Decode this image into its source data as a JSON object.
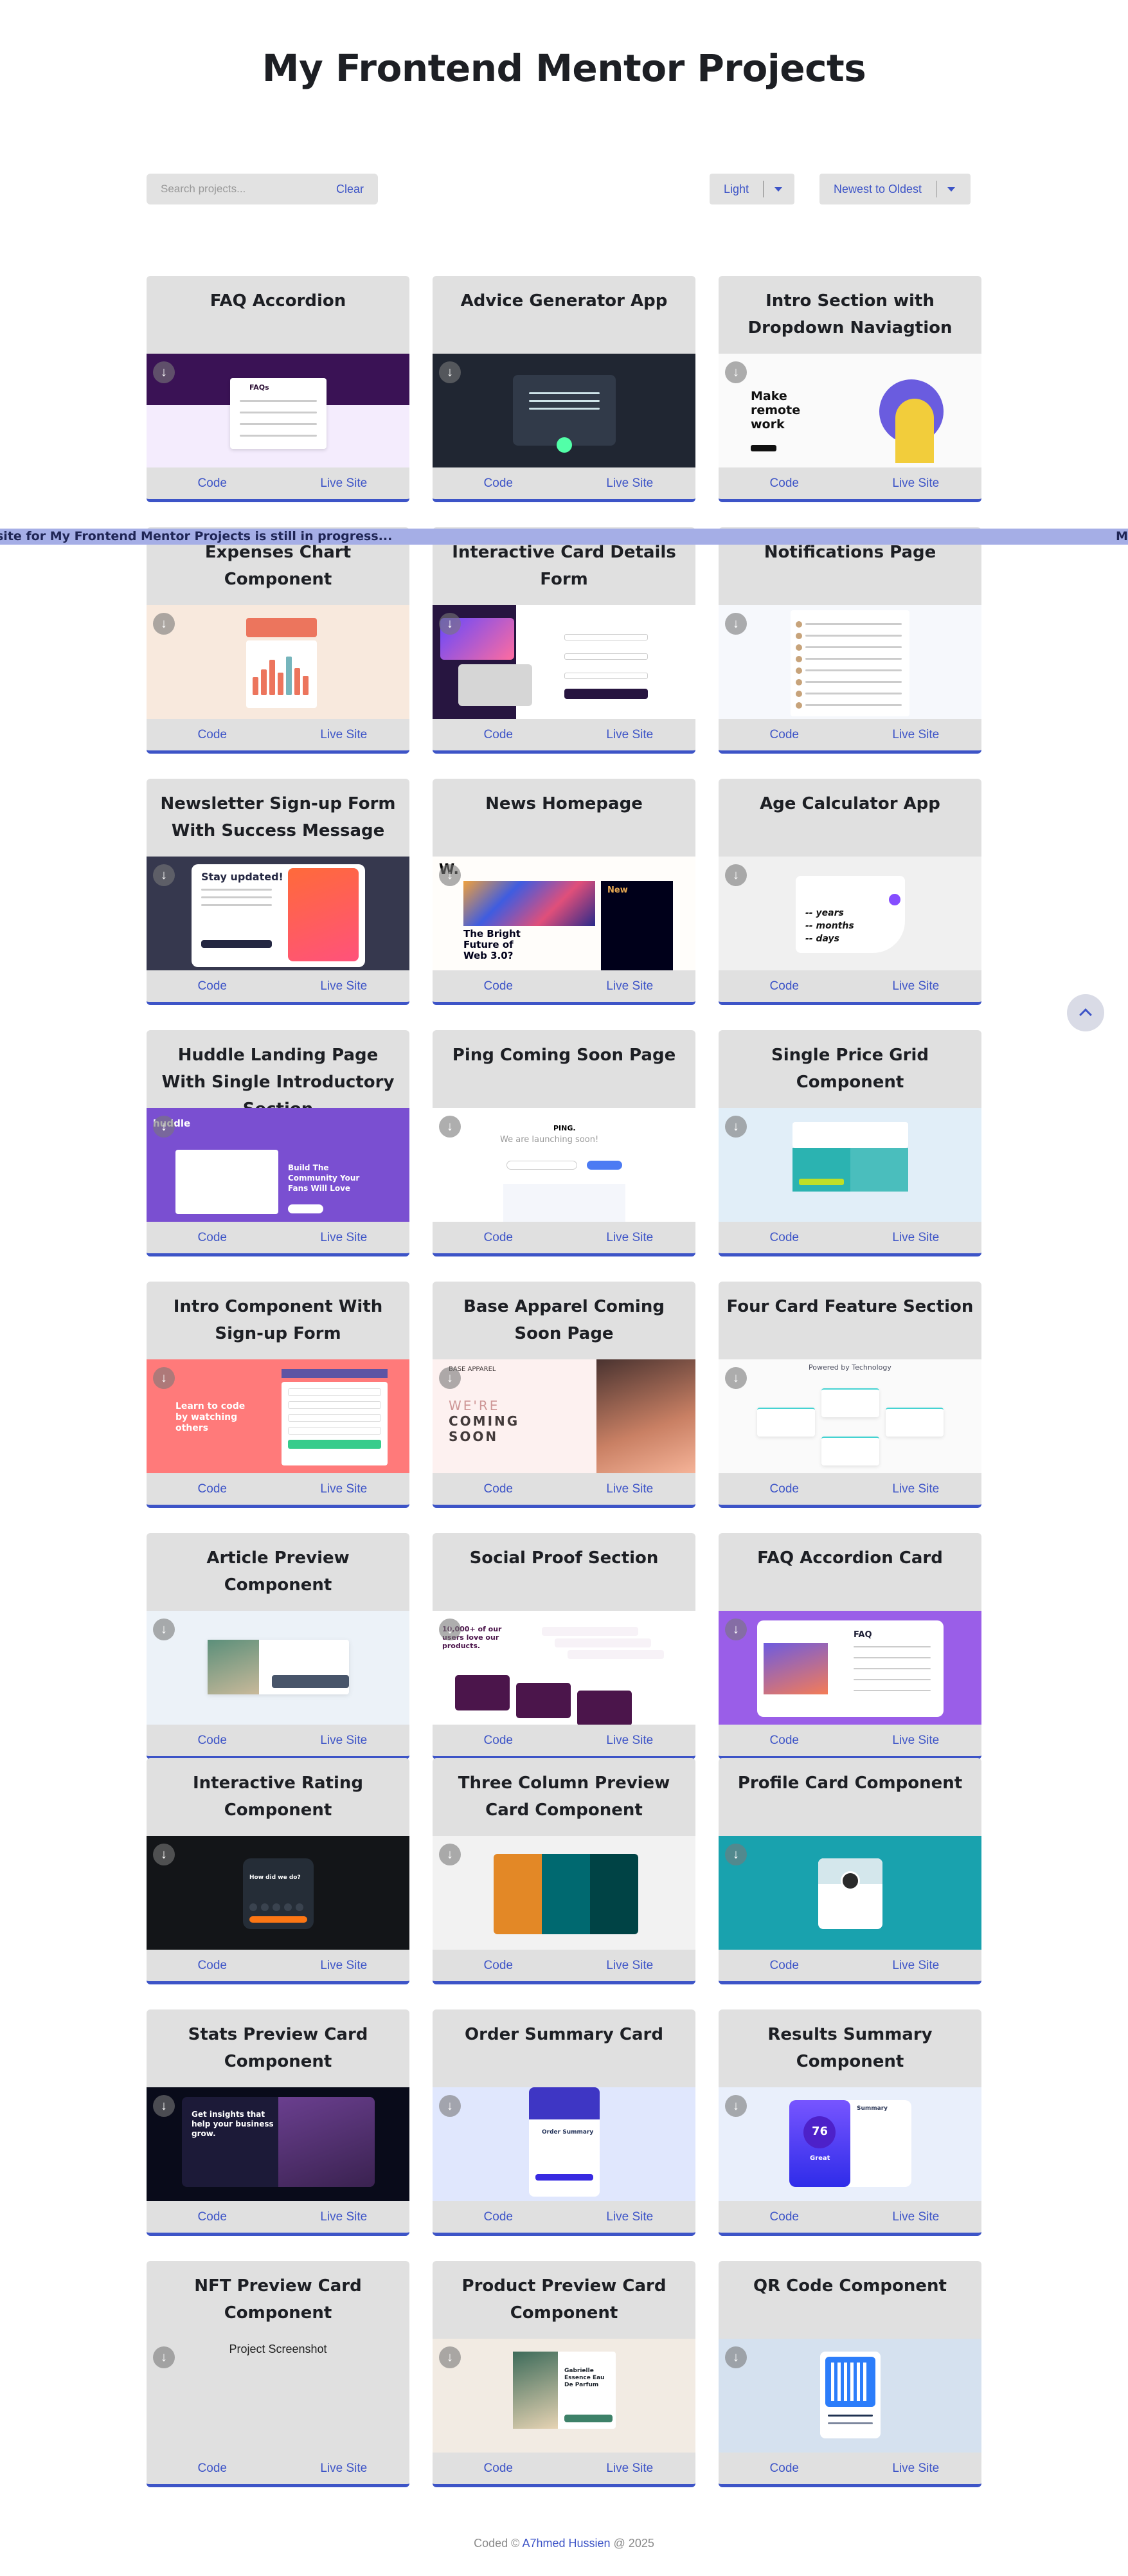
{
  "page": {
    "title": "My Frontend Mentor Projects"
  },
  "search": {
    "placeholder": "Search projects...",
    "value": "",
    "clear_label": "Clear"
  },
  "theme_select": {
    "value": "Light"
  },
  "sort_select": {
    "value": "Newest to Oldest"
  },
  "marquee": {
    "text": "site for My Frontend Mentor Projects is still in progress...",
    "text_tail": "M"
  },
  "card_links": {
    "code": "Code",
    "live": "Live Site"
  },
  "cards": [
    {
      "title": "FAQ Accordion",
      "thumb": "faq-accordion",
      "bg": "#f4ecfd"
    },
    {
      "title": "Advice Generator App",
      "thumb": "advice",
      "bg": "#202632"
    },
    {
      "title": "Intro Section with Dropdown Naviagtion",
      "thumb": "intro-dropdown",
      "bg": "#fafafa"
    },
    {
      "title": "Expenses Chart Component",
      "thumb": "expenses",
      "bg": "#f8e9dd"
    },
    {
      "title": "Interactive Card Details Form",
      "thumb": "card-form",
      "bg": "#ffffff"
    },
    {
      "title": "Notifications Page",
      "thumb": "notifications",
      "bg": "#f6f8fc"
    },
    {
      "title": "Newsletter Sign-up Form With Success Message",
      "thumb": "newsletter",
      "bg": "#36384e"
    },
    {
      "title": "News Homepage",
      "thumb": "news",
      "bg": "#fffdfa"
    },
    {
      "title": "Age Calculator App",
      "thumb": "age",
      "bg": "#f0f0f0"
    },
    {
      "title": "Huddle Landing Page With Single Introductory Section",
      "thumb": "huddle",
      "bg": "#7a4fd1"
    },
    {
      "title": "Ping Coming Soon Page",
      "thumb": "ping",
      "bg": "#ffffff"
    },
    {
      "title": "Single Price Grid Component",
      "thumb": "price-grid",
      "bg": "#e1eef8"
    },
    {
      "title": "Intro Component With Sign-up Form",
      "thumb": "intro-signup",
      "bg": "#ff7a7a"
    },
    {
      "title": "Base Apparel Coming Soon Page",
      "thumb": "base-apparel",
      "bg": "#fdf1f0"
    },
    {
      "title": "Four Card Feature Section",
      "thumb": "four-card",
      "bg": "#fafafa"
    },
    {
      "title": "Article Preview Component",
      "thumb": "article",
      "bg": "#ecf2f8"
    },
    {
      "title": "Social Proof Section",
      "thumb": "social-proof",
      "bg": "#ffffff"
    },
    {
      "title": "FAQ Accordion Card",
      "thumb": "faq-card",
      "bg": "#9a5ee8"
    },
    {
      "title": "Interactive Rating Component",
      "thumb": "rating",
      "bg": "#131518"
    },
    {
      "title": "Three Column Preview Card Component",
      "thumb": "three-col",
      "bg": "#f2f2f2"
    },
    {
      "title": "Profile Card Component",
      "thumb": "profile",
      "bg": "#19a2ae"
    },
    {
      "title": "Stats Preview Card Component",
      "thumb": "stats",
      "bg": "#090b1a"
    },
    {
      "title": "Order Summary Card",
      "thumb": "order",
      "bg": "#e0e7fd"
    },
    {
      "title": "Results Summary Component",
      "thumb": "results",
      "bg": "#e9effb"
    },
    {
      "title": "NFT Preview Card Component",
      "thumb": "nft",
      "bg": "#e0e0e0",
      "alt": "Project Screenshot"
    },
    {
      "title": "Product Preview Card Component",
      "thumb": "product",
      "bg": "#f2ebe3"
    },
    {
      "title": "QR Code Component",
      "thumb": "qr",
      "bg": "#d5e1ef"
    }
  ],
  "thumbnail_text": {
    "faq": "FAQs",
    "make_remote": "Make remote work",
    "stay_updated": "Stay updated!",
    "news_new": "New",
    "bright_future": "The Bright Future of Web 3.0?",
    "age_years": "-- years",
    "age_months": "-- months",
    "age_days": "-- days",
    "huddle_logo": "huddle",
    "huddle_headline": "Build The Community Your Fans Will Love",
    "ping_logo": "PING.",
    "ping_headline": "We are launching soon!",
    "learn_code": "Learn to code by watching others",
    "coming_soon_1": "WE'RE",
    "coming_soon_2": "COMING",
    "coming_soon_3": "SOON",
    "powered": "Powered by Technology",
    "social_headline": "10,000+ of our users love our products.",
    "faq_card": "FAQ",
    "rating_q": "How did we do?",
    "stats_headline": "Get insights that help your business grow.",
    "order_title": "Order Summary",
    "result_score": "76",
    "result_great": "Great",
    "summary": "Summary",
    "product_title": "Gabrielle Essence Eau De Parfum"
  },
  "footer": {
    "prefix": "Coded © ",
    "author": "A7hmed Hussien",
    "suffix": " @ 2025"
  },
  "colors": {
    "accent": "#3d54c7",
    "card_bg": "#e0e0e0",
    "marquee_bg": "#a5aee6"
  },
  "icons": {
    "download": "arrow-down-icon",
    "scroll_top": "chevron-up-icon",
    "select_caret": "caret-down-icon"
  }
}
